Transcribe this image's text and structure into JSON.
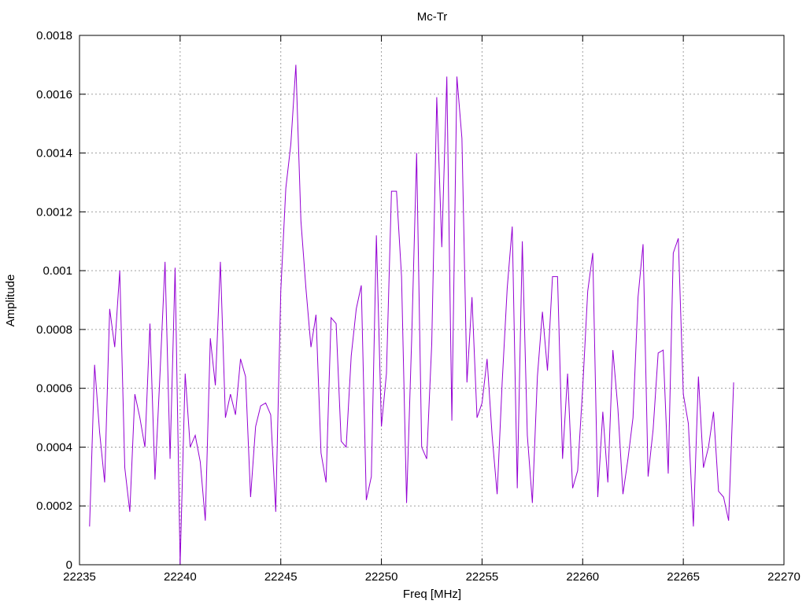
{
  "chart_data": {
    "type": "line",
    "title": "Mc-Tr",
    "xlabel": "Freq [MHz]",
    "ylabel": "Amplitude",
    "xlim": [
      22235,
      22270
    ],
    "ylim": [
      0,
      0.0018
    ],
    "x_ticks": [
      22235,
      22240,
      22245,
      22250,
      22255,
      22260,
      22265,
      22270
    ],
    "x_tick_labels": [
      "22235",
      "22240",
      "22245",
      "22250",
      "22255",
      "22260",
      "22265",
      "22270"
    ],
    "y_ticks": [
      0,
      0.0002,
      0.0004,
      0.0006,
      0.0008,
      0.001,
      0.0012,
      0.0014,
      0.0016,
      0.0018
    ],
    "y_tick_labels": [
      "0",
      "0.0002",
      "0.0004",
      "0.0006",
      "0.0008",
      "0.001",
      "0.0012",
      "0.0014",
      "0.0016",
      "0.0018"
    ],
    "grid": true,
    "series": [
      {
        "color": "#9400d3",
        "x": [
          22235.5,
          22235.75,
          22236.0,
          22236.25,
          22236.5,
          22236.75,
          22237.0,
          22237.25,
          22237.5,
          22237.75,
          22238.0,
          22238.25,
          22238.5,
          22238.75,
          22239.0,
          22239.25,
          22239.5,
          22239.75,
          22240.0,
          22240.25,
          22240.5,
          22240.75,
          22241.0,
          22241.25,
          22241.5,
          22241.75,
          22242.0,
          22242.25,
          22242.5,
          22242.75,
          22243.0,
          22243.25,
          22243.5,
          22243.75,
          22244.0,
          22244.25,
          22244.5,
          22244.75,
          22245.0,
          22245.25,
          22245.5,
          22245.75,
          22246.0,
          22246.25,
          22246.5,
          22246.75,
          22247.0,
          22247.25,
          22247.5,
          22247.75,
          22248.0,
          22248.25,
          22248.5,
          22248.75,
          22249.0,
          22249.25,
          22249.5,
          22249.75,
          22250.0,
          22250.25,
          22250.5,
          22250.75,
          22251.0,
          22251.25,
          22251.5,
          22251.75,
          22252.0,
          22252.25,
          22252.5,
          22252.75,
          22253.0,
          22253.25,
          22253.5,
          22253.75,
          22254.0,
          22254.25,
          22254.5,
          22254.75,
          22255.0,
          22255.25,
          22255.5,
          22255.75,
          22256.0,
          22256.25,
          22256.5,
          22256.75,
          22257.0,
          22257.25,
          22257.5,
          22257.75,
          22258.0,
          22258.25,
          22258.5,
          22258.75,
          22259.0,
          22259.25,
          22259.5,
          22259.75,
          22260.0,
          22260.25,
          22260.5,
          22260.75,
          22261.0,
          22261.25,
          22261.5,
          22261.75,
          22262.0,
          22262.25,
          22262.5,
          22262.75,
          22263.0,
          22263.25,
          22263.5,
          22263.75,
          22264.0,
          22264.25,
          22264.5,
          22264.75,
          22265.0,
          22265.25,
          22265.5,
          22265.75,
          22266.0,
          22266.25,
          22266.5,
          22266.75,
          22267.0,
          22267.25,
          22267.5
        ],
        "values": [
          0.00013,
          0.00068,
          0.00045,
          0.00028,
          0.00087,
          0.00074,
          0.001,
          0.00033,
          0.00018,
          0.00058,
          0.0005,
          0.0004,
          0.00082,
          0.00029,
          0.00065,
          0.00103,
          0.00036,
          0.00101,
          0.0,
          0.00065,
          0.0004,
          0.00044,
          0.00035,
          0.00015,
          0.00077,
          0.00061,
          0.00103,
          0.0005,
          0.00058,
          0.00051,
          0.0007,
          0.00064,
          0.00023,
          0.00047,
          0.00054,
          0.00055,
          0.00051,
          0.00018,
          0.00093,
          0.00128,
          0.00143,
          0.0017,
          0.00117,
          0.00094,
          0.00074,
          0.00085,
          0.00038,
          0.00028,
          0.00084,
          0.00082,
          0.00042,
          0.0004,
          0.00071,
          0.00087,
          0.00095,
          0.00022,
          0.0003,
          0.00112,
          0.00047,
          0.00065,
          0.00127,
          0.00127,
          0.00098,
          0.00021,
          0.00076,
          0.0014,
          0.0004,
          0.00036,
          0.00075,
          0.00159,
          0.00108,
          0.00166,
          0.00049,
          0.00166,
          0.00145,
          0.00062,
          0.00091,
          0.0005,
          0.00055,
          0.0007,
          0.00044,
          0.00024,
          0.00062,
          0.00094,
          0.00115,
          0.00026,
          0.0011,
          0.00044,
          0.00021,
          0.00064,
          0.00086,
          0.00066,
          0.00098,
          0.00098,
          0.00036,
          0.00065,
          0.00026,
          0.00032,
          0.0006,
          0.00093,
          0.00106,
          0.00023,
          0.00052,
          0.00028,
          0.00073,
          0.00053,
          0.00024,
          0.00036,
          0.0005,
          0.00091,
          0.00109,
          0.0003,
          0.00046,
          0.00072,
          0.00073,
          0.00031,
          0.00106,
          0.00111,
          0.00058,
          0.00048,
          0.00013,
          0.00064,
          0.00033,
          0.0004,
          0.00052,
          0.00025,
          0.00023,
          0.00015,
          0.00062
        ]
      }
    ]
  }
}
